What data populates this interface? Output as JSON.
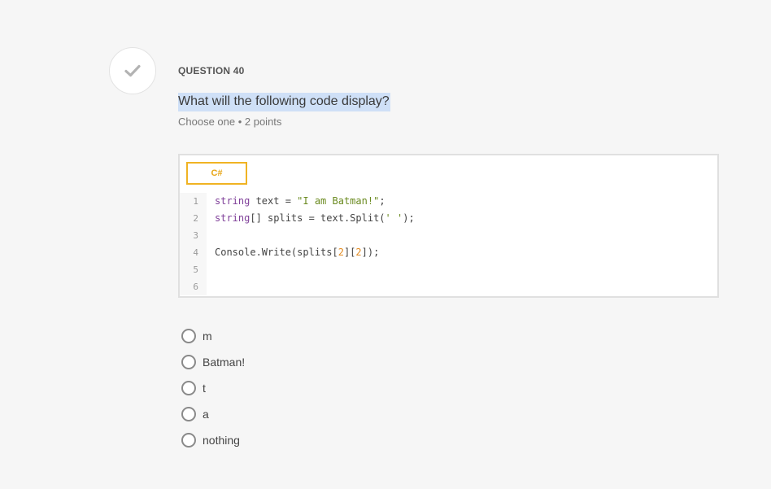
{
  "question": {
    "number_label": "QUESTION 40",
    "text": "What will the following code display?",
    "meta": "Choose one • 2 points",
    "status_icon": "checkmark-icon"
  },
  "code_block": {
    "language": "C#",
    "lines": [
      {
        "number": "1",
        "tokens": [
          {
            "t": "string",
            "c": "kw"
          },
          {
            "t": " text = ",
            "c": ""
          },
          {
            "t": "\"I am Batman!\"",
            "c": "str"
          },
          {
            "t": ";",
            "c": ""
          }
        ]
      },
      {
        "number": "2",
        "tokens": [
          {
            "t": "string",
            "c": "kw"
          },
          {
            "t": "[] splits = text.Split(",
            "c": ""
          },
          {
            "t": "' '",
            "c": "str"
          },
          {
            "t": ");",
            "c": ""
          }
        ]
      },
      {
        "number": "3",
        "tokens": []
      },
      {
        "number": "4",
        "tokens": [
          {
            "t": "Console.Write(splits[",
            "c": ""
          },
          {
            "t": "2",
            "c": "num"
          },
          {
            "t": "][",
            "c": ""
          },
          {
            "t": "2",
            "c": "num"
          },
          {
            "t": "]);",
            "c": ""
          }
        ]
      },
      {
        "number": "5",
        "tokens": []
      },
      {
        "number": "6",
        "tokens": []
      }
    ]
  },
  "options": [
    {
      "label": "m"
    },
    {
      "label": "Batman!"
    },
    {
      "label": "t"
    },
    {
      "label": "a"
    },
    {
      "label": "nothing"
    }
  ],
  "colors": {
    "background": "#f6f6f6",
    "highlight": "#cfe0f7",
    "lang_accent": "#f0b323",
    "keyword": "#7f3f99",
    "string": "#6a8a1f",
    "number": "#e38b21"
  }
}
